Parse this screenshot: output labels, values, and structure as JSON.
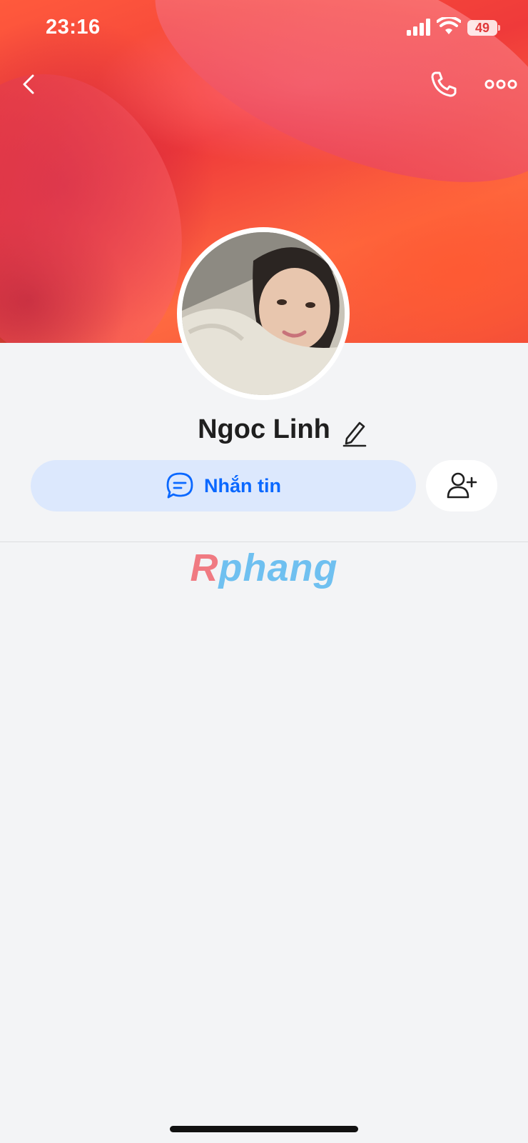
{
  "status_bar": {
    "time": "23:16",
    "battery": "49"
  },
  "top_bar": {
    "back_icon": "chevron-left-icon",
    "call_icon": "phone-icon",
    "more_icon": "more-horizontal-icon"
  },
  "profile": {
    "name": "Ngoc Linh",
    "edit_icon": "pencil-icon"
  },
  "actions": {
    "message_label": "Nhắn tin",
    "message_icon": "chat-bubble-icon",
    "add_friend_icon": "add-user-icon"
  },
  "watermark": {
    "text_r": "R",
    "text_rest": "phang"
  },
  "colors": {
    "accent": "#0a68ff",
    "message_button_bg": "#dce8fd",
    "page_bg": "#f3f4f6"
  }
}
